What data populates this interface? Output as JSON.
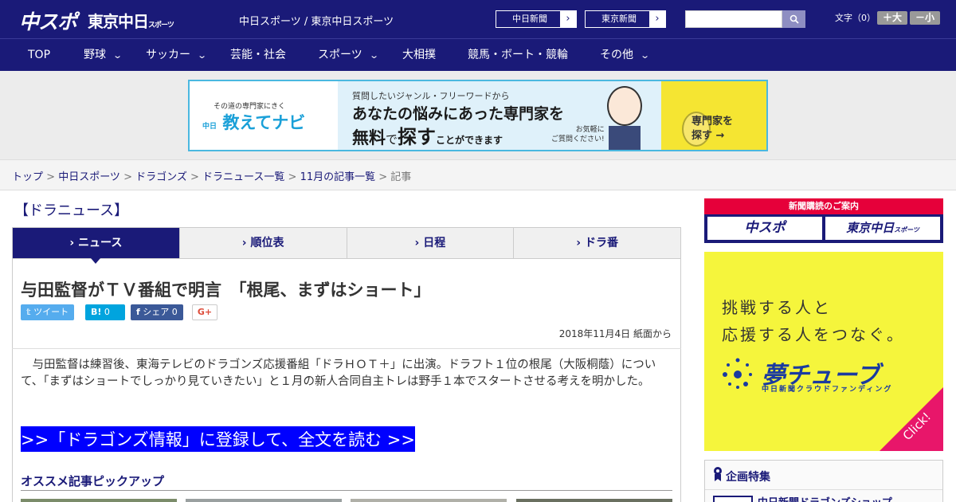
{
  "header": {
    "logo_main": "中スポ",
    "logo_tokyo": "東京中日",
    "logo_tokyo_small": "スポーツ",
    "site_names": "中日スポーツ / 東京中日スポーツ",
    "site_buttons": [
      {
        "label": "中日新聞"
      },
      {
        "label": "東京新聞"
      }
    ],
    "search": {
      "placeholder": ""
    },
    "font_size_label": "文字（0）",
    "font_larger": "＋大",
    "font_smaller": "－小"
  },
  "nav": {
    "items": [
      {
        "label": "TOP",
        "has_dropdown": false
      },
      {
        "label": "野球",
        "has_dropdown": true
      },
      {
        "label": "サッカー",
        "has_dropdown": true
      },
      {
        "label": "芸能・社会",
        "has_dropdown": false
      },
      {
        "label": "スポーツ",
        "has_dropdown": true
      },
      {
        "label": "大相撲",
        "has_dropdown": false
      },
      {
        "label": "競馬・ボート・競輪",
        "has_dropdown": false
      },
      {
        "label": "その他",
        "has_dropdown": true
      }
    ]
  },
  "banner": {
    "small_caption": "その道の専門家にきく",
    "logo_prefix": "中日",
    "logo": "教えてナビ",
    "line1": "質問したいジャンル・フリーワードから",
    "line2": "あなたの悩みにあった専門家を",
    "line3_a": "無料",
    "line3_b": "で",
    "line3_c": "探す",
    "line3_d": "ことができます",
    "note1": "お気軽に",
    "note2": "ご質問ください!",
    "cta1": "専門家を",
    "cta2": "探す →"
  },
  "breadcrumb": [
    {
      "label": "トップ",
      "link": true
    },
    {
      "label": "中日スポーツ",
      "link": true
    },
    {
      "label": "ドラゴンズ",
      "link": true
    },
    {
      "label": "ドラニュース一覧",
      "link": true
    },
    {
      "label": "11月の記事一覧",
      "link": true
    },
    {
      "label": "記事",
      "link": false
    }
  ],
  "section_title": "【ドラニュース】",
  "tabs": [
    {
      "label": "ニュース",
      "active": true
    },
    {
      "label": "順位表",
      "active": false
    },
    {
      "label": "日程",
      "active": false
    },
    {
      "label": "ドラ番",
      "active": false
    }
  ],
  "article": {
    "headline": "与田監督がＴＶ番組で明言　「根尾、まずはショート」",
    "share": {
      "tweet": "ツイート",
      "hatena_count": "0",
      "facebook": "シェア 0"
    },
    "date": "2018年11月4日 紙面から",
    "body": "　与田監督は練習後、東海テレビのドラゴンズ応援番組「ドラＨＯＴ＋」に出演。ドラフト１位の根尾（大阪桐蔭）について、「まずはショートでしっかり見ていきたい」と１月の新人合同自主トレは野手１本でスタートさせる考えを明かした。",
    "read_more": ">>「ドラゴンズ情報」に登録して、全文を読む >>",
    "pickup_title": "オススメ記事ピックアップ"
  },
  "sidebar": {
    "subscribe_label": "新聞購読のご案内",
    "subscribe_a": "中スポ",
    "subscribe_b": "東京中日",
    "subscribe_b_small": "スポーツ",
    "ad_line1": "挑戦する人と",
    "ad_line2": "応援する人をつなぐ。",
    "ad_logo": "夢チューブ",
    "ad_sub": "中日新聞クラウドファンディング",
    "ad_click": "Click!",
    "feature_title": "企画特集",
    "feature_item": "中日新聞ドラゴンズショップ"
  },
  "colors": {
    "brand_navy": "#1a1a78",
    "link_blue": "#0000ff",
    "twitter": "#55acee",
    "hatena": "#00a4de",
    "facebook": "#3b5998"
  }
}
